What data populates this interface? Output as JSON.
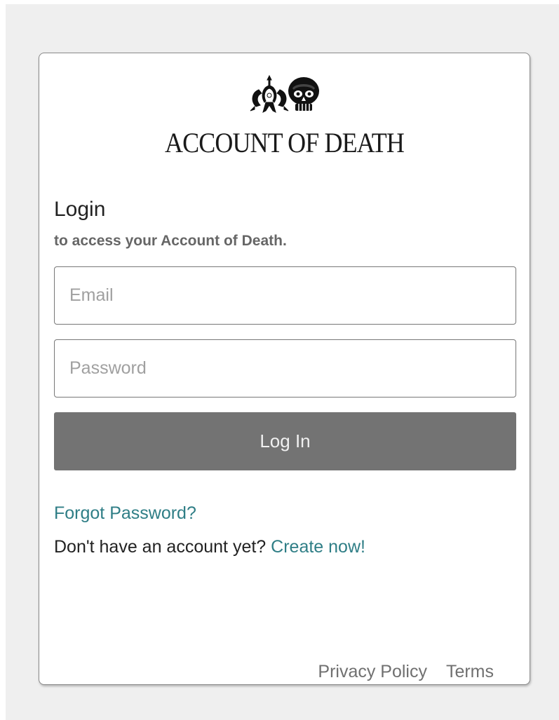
{
  "brand": {
    "name": "ACCOUNT OF DEATH",
    "logo_icons": [
      "trident-crest-icon",
      "skull-icon"
    ]
  },
  "login": {
    "title": "Login",
    "subtitle": "to access your Account of Death."
  },
  "form": {
    "email": {
      "placeholder": "Email",
      "value": ""
    },
    "password": {
      "placeholder": "Password",
      "value": ""
    },
    "submit_label": "Log In"
  },
  "links": {
    "forgot_password": "Forgot Password?",
    "no_account_text": "Don't have an account yet?",
    "create_now": "Create now!"
  },
  "footer": {
    "privacy": "Privacy Policy",
    "terms": "Terms"
  },
  "colors": {
    "page_background": "#efefef",
    "card_background": "#ffffff",
    "button_background": "#737373",
    "link": "#2f7e86"
  }
}
